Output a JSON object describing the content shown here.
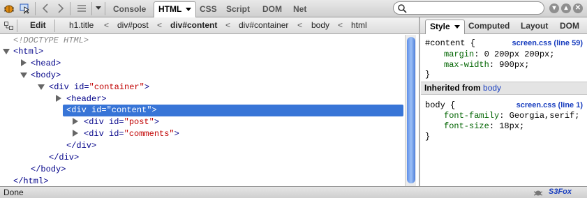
{
  "toolbar": {
    "tabs": [
      "Console",
      "HTML",
      "CSS",
      "Script",
      "DOM",
      "Net"
    ],
    "active_tab": "HTML",
    "search": {
      "value": "",
      "placeholder": ""
    }
  },
  "breadcrumb": {
    "edit_label": "Edit",
    "items": [
      "h1.title",
      "div#post",
      "div#content",
      "div#container",
      "body",
      "html"
    ],
    "selected": "div#content",
    "separator": "<"
  },
  "side_tabs": {
    "items": [
      "Style",
      "Computed",
      "Layout",
      "DOM"
    ],
    "active": "Style"
  },
  "tree": {
    "doctype": "<!DOCTYPE HTML>",
    "html_open": "<html>",
    "head": "<head>",
    "body_open": "<body>",
    "container_open_tag": "<div ",
    "container_attr": "id=",
    "container_val": "\"container\"",
    "container_close_bracket": ">",
    "header": "<header>",
    "content_line": "<div id=\"content\">",
    "post_tag": "<div ",
    "post_attr": "id=",
    "post_val": "\"post\"",
    "post_end": ">",
    "comments_tag": "<div ",
    "comments_attr": "id=",
    "comments_val": "\"comments\"",
    "comments_end": ">",
    "div_close_inner": "</div>",
    "div_close_outer": "</div>",
    "body_close": "</body>",
    "html_close": "</html>"
  },
  "style_panel": {
    "rule1_selector": "#content {",
    "rule1_source": "screen.css (line 59)",
    "rule1_prop1_name": "margin",
    "rule1_prop1_value": ": 0 200px 200px;",
    "rule1_prop2_name": "max-width",
    "rule1_prop2_value": ": 900px;",
    "rule1_close": "}",
    "inherited_label": "Inherited from",
    "inherited_link": "body",
    "rule2_selector": "body {",
    "rule2_source": "screen.css (line 1)",
    "rule2_prop1_name": "font-family",
    "rule2_prop1_value": ": Georgia,serif;",
    "rule2_prop2_name": "font-size",
    "rule2_prop2_value": ": 18px;",
    "rule2_close": "}"
  },
  "statusbar": {
    "status": "Done",
    "addon": "S3Fox"
  },
  "colors": {
    "selection": "#3875d7",
    "link": "#1a3fbf",
    "attr_value": "#c00000",
    "tag": "#000088"
  }
}
